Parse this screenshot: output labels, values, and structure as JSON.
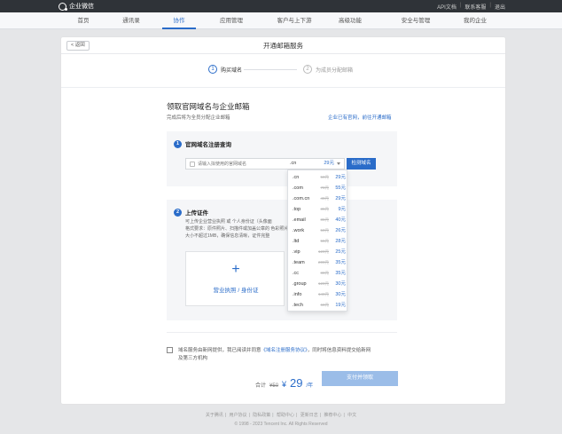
{
  "topbar": {
    "brand": "企业微信",
    "links": [
      "API文档",
      "联系客服",
      "退出"
    ]
  },
  "nav": {
    "items": [
      "首页",
      "通讯录",
      "协作",
      "应用管理",
      "客户与上下游",
      "高级功能",
      "安全与管理",
      "我的企业"
    ],
    "active_index": 2
  },
  "card": {
    "back_label": "< 返回",
    "title": "开通邮箱服务"
  },
  "steps": [
    {
      "num": "1",
      "label": "购买域名",
      "active": true
    },
    {
      "num": "2",
      "label": "为成员分配邮箱",
      "active": false
    }
  ],
  "section": {
    "title": "领取官网域名与企业邮箱",
    "subtitle": "完成后将为全员分配企业邮箱",
    "link": "企业已有官网，前往开通邮箱"
  },
  "panel1": {
    "num": "1",
    "title": "官网域名注册查询",
    "search_placeholder": "请输入拟使用的官网域名",
    "selected_suffix": ".cn",
    "selected_price": "29元",
    "query_button": "检测域名"
  },
  "domain_options": [
    {
      "suffix": ".cn",
      "old": "50元",
      "new": "29元"
    },
    {
      "suffix": ".com",
      "old": "70元",
      "new": "55元"
    },
    {
      "suffix": ".com.cn",
      "old": "45元",
      "new": "29元"
    },
    {
      "suffix": ".top",
      "old": "35元",
      "new": "9元"
    },
    {
      "suffix": ".email",
      "old": "85元",
      "new": "40元"
    },
    {
      "suffix": ".work",
      "old": "50元",
      "new": "26元"
    },
    {
      "suffix": ".ltd",
      "old": "55元",
      "new": "28元"
    },
    {
      "suffix": ".vip",
      "old": "120元",
      "new": "25元"
    },
    {
      "suffix": ".team",
      "old": "200元",
      "new": "35元"
    },
    {
      "suffix": ".cc",
      "old": "80元",
      "new": "35元"
    },
    {
      "suffix": ".group",
      "old": "120元",
      "new": "30元"
    },
    {
      "suffix": ".info",
      "old": "140元",
      "new": "30元"
    },
    {
      "suffix": ".tech",
      "old": "60元",
      "new": "19元"
    }
  ],
  "panel2": {
    "num": "2",
    "title": "上传证件",
    "desc_lines": [
      "可上传企业营业执照 或 个人身份证（头像面",
      "格式要求：原件照片、扫描件或加盖公章的                          色彩照片，",
      "大小不超过1MB，确保信息清晰，证件完整"
    ],
    "upload_plus": "+",
    "upload_label": "营业执照 / 身份证"
  },
  "agreement": {
    "line1_a": "域名服务由新网提供，我已阅读并同意",
    "line1_link": "《域名注册服务协议》",
    "line1_b": "，同时将信息资料提交给新网",
    "line2": "及第三方机构"
  },
  "total": {
    "label": "合计",
    "old": "¥50",
    "currency": "¥",
    "value": "29",
    "unit": "/年",
    "button": "支付并领取"
  },
  "footer": {
    "links": [
      "关于腾讯",
      "用户协议",
      "隐私政策",
      "帮助中心",
      "更新日志",
      "推荐中心",
      "中文"
    ],
    "copyright": "© 1998 - 2023 Tencent Inc. All Rights Reserved"
  },
  "colors": {
    "accent": "#2a6cc9",
    "topbar": "#2f3338",
    "disabled_button": "#9bbde8"
  }
}
